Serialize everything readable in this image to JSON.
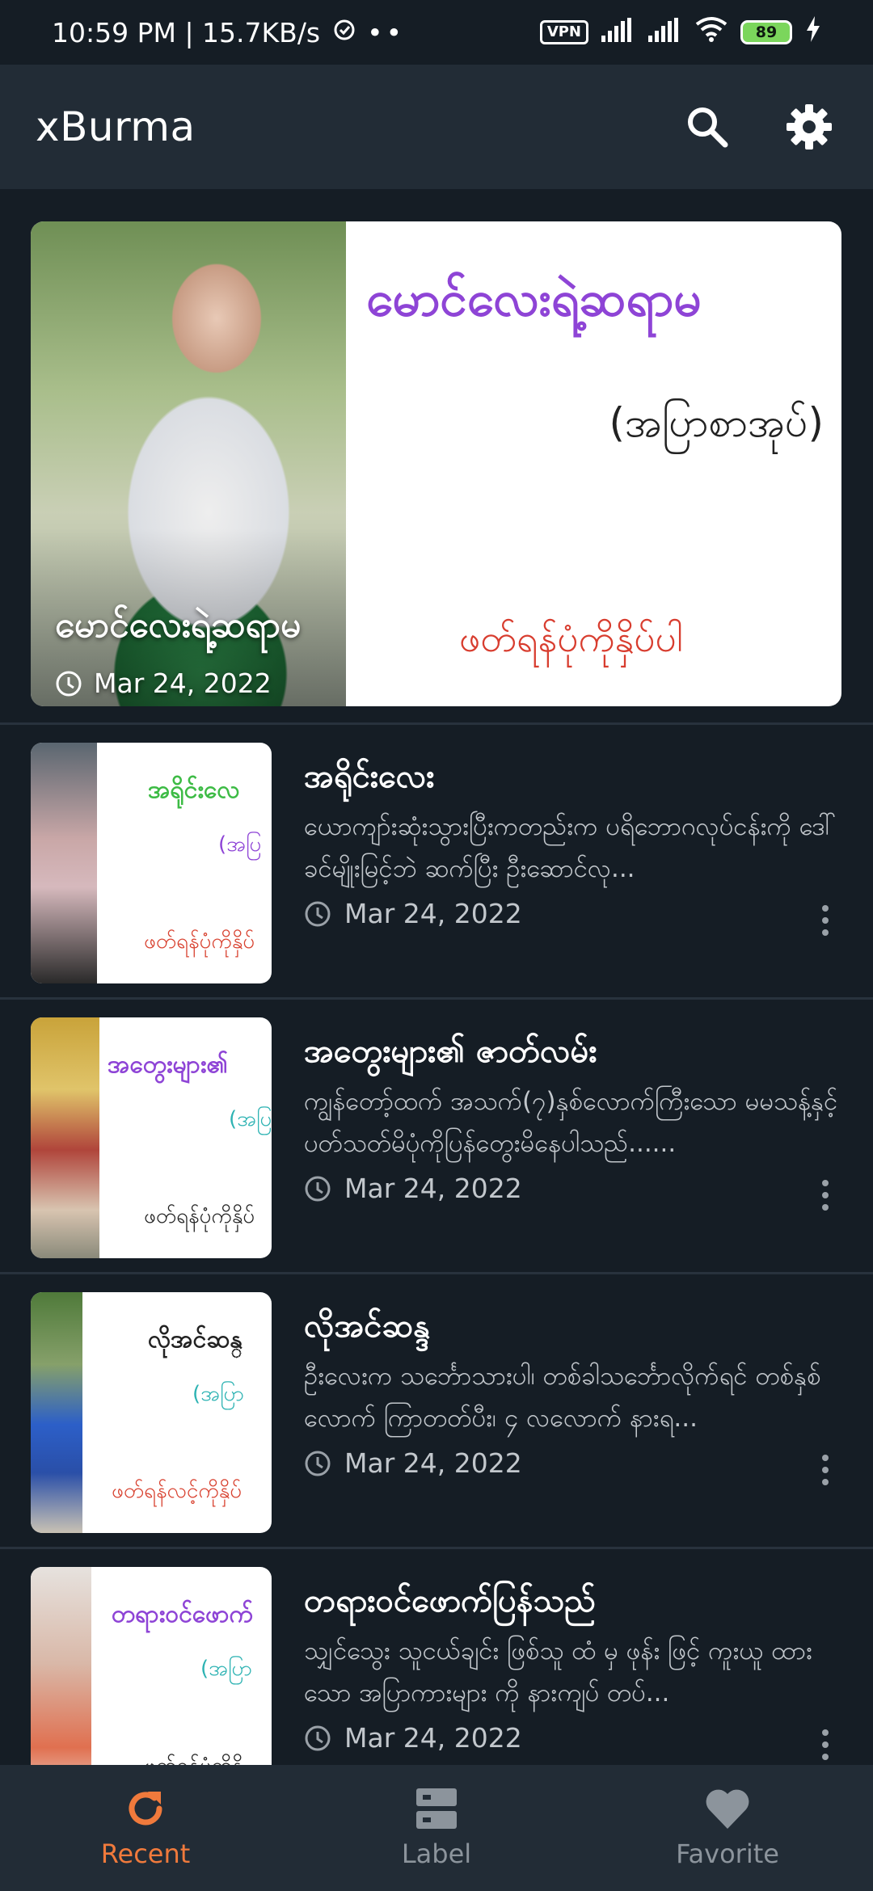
{
  "status_bar": {
    "time_speed": "10:59 PM | 15.7KB/s",
    "vpn": "VPN",
    "battery": "89"
  },
  "app_bar": {
    "title": "xBurma",
    "search_icon": "search-icon",
    "settings_icon": "gear-icon"
  },
  "featured": {
    "art_title": "မောင်လေးရဲ့ဆရာမ",
    "art_subtitle": "(အပြာစာအုပ်)",
    "art_cta": "ဖတ်ရန်ပုံကိုနှိပ်ပါ",
    "title": "မောင်လေးရဲ့ဆရာမ",
    "date": "Mar 24, 2022"
  },
  "posts": [
    {
      "thumb_title": "အရိုင်းလေ",
      "thumb_sub": "(အပြ",
      "thumb_cta": "ဖတ်ရန်ပုံကိုနှိပ်",
      "title": "အရိုင်းလေး",
      "excerpt": "ယောကျာ်းဆုံးသွားပြီးကတည်းက ပရိဘောဂလုပ်ငန်းကို ဒေါ်ခင်မျိုးမြင့်ဘဲ ဆက်ပြီး ဦးဆောင်လု...",
      "date": "Mar 24, 2022"
    },
    {
      "thumb_title": "အတွေးများ၏",
      "thumb_sub": "(အပြ",
      "thumb_cta": "ဖတ်ရန်ပုံကိုနှိပ်",
      "title": "အတွေးများ၏ ဇာတ်လမ်း",
      "excerpt": "ကျွန်တော့်ထက် အသက်(၇)နှစ်လောက်ကြီးသော မမသန့်နှင့် ပတ်သတ်မိပုံကိုပြန်တွေးမိနေပါသည်......",
      "date": "Mar 24, 2022"
    },
    {
      "thumb_title": "လိုအင်ဆန္",
      "thumb_sub": "(အပြာ",
      "thumb_cta": "ဖတ်ရန်လင့်ကိုနှိပ်",
      "title": "လိုအင်ဆန္ဒ",
      "excerpt": "ဦးလေးက သင်္ဘောသားပါ၊ တစ်ခါသင်္ဘောလိုက်ရင် တစ်နှစ်လောက် ကြာတတ်ပီး၊ ၄ လလောက် နားရ...",
      "date": "Mar 24, 2022"
    },
    {
      "thumb_title": "တရားဝင်ဖောက်",
      "thumb_sub": "(အပြာ",
      "thumb_cta": "ဖတ်ရန်ပုံကိုနှိ",
      "title": "တရားဝင်ဖောက်ပြန်သည်",
      "excerpt": "သျှင်သွေး သူငယ်ချင်း ဖြစ်သူ ထံ မှ ဖုန်း ဖြင့် ကူးယူ ထားသော အပြာကားများ ကို နားကျပ် တပ်...",
      "date": "Mar 24, 2022"
    }
  ],
  "bottom_nav": {
    "recent": "Recent",
    "label": "Label",
    "favorite": "Favorite"
  },
  "colors": {
    "background": "#151d25",
    "app_bar": "#222c36",
    "accent": "#f07a3c"
  }
}
